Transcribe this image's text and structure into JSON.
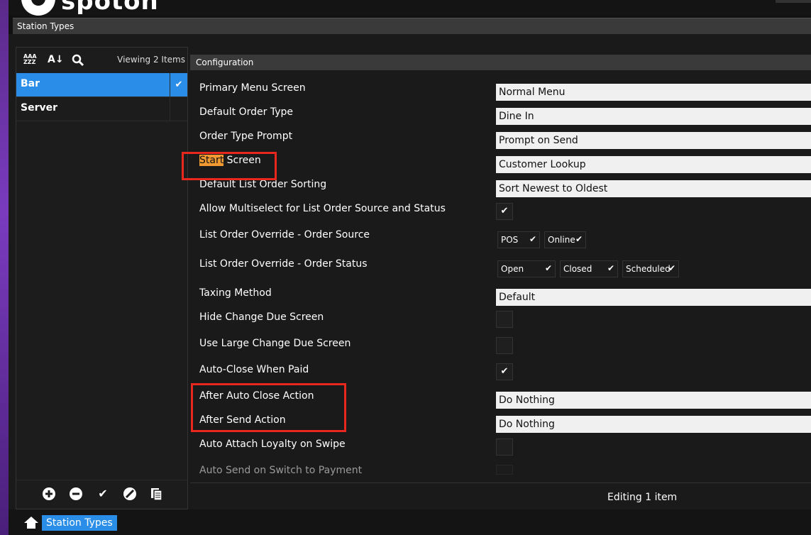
{
  "app": {
    "brand": "spoton"
  },
  "window": {
    "title": "Station Types"
  },
  "left_panel": {
    "toolbar": {
      "sort_az_icon": "AAA\nZZZ",
      "sort_num_icon": "A↓Z",
      "search_icon": "🔍",
      "viewing_text": "Viewing 2 Items"
    },
    "items": [
      {
        "label": "Bar",
        "selected": true,
        "check": "✔"
      },
      {
        "label": "Server",
        "selected": false,
        "check": ""
      }
    ],
    "bottom_icons": [
      "add-icon",
      "remove-icon",
      "check-icon",
      "disable-icon",
      "copy-icon"
    ]
  },
  "config": {
    "header": "Configuration",
    "rows": [
      {
        "label": "Primary Menu Screen",
        "value": "Normal Menu"
      },
      {
        "label": "Default Order Type",
        "value": "Dine In"
      },
      {
        "label": "Order Type Prompt",
        "value": "Prompt on Send"
      },
      {
        "label_highlight": "Start",
        "label_rest": " Screen",
        "value": "Customer Lookup"
      },
      {
        "label": "Default List Order Sorting",
        "value": "Sort Newest to Oldest"
      },
      {
        "label": "Allow Multiselect for List Order Source and Status",
        "checked": "✔"
      },
      {
        "label": "List Order Override - Order Source",
        "chips": [
          {
            "label": "POS",
            "check": "✔"
          },
          {
            "label": "Online",
            "check": "✔"
          }
        ]
      },
      {
        "label": "List Order Override - Order Status",
        "chips": [
          {
            "label": "Open",
            "check": "✔"
          },
          {
            "label": "Closed",
            "check": "✔"
          },
          {
            "label": "Scheduled",
            "check": "✔"
          }
        ]
      },
      {
        "label": "Taxing Method",
        "value": "Default"
      },
      {
        "label": "Hide Change Due Screen",
        "checked": ""
      },
      {
        "label": "Use Large Change Due Screen",
        "checked": ""
      },
      {
        "label": "Auto-Close When Paid",
        "checked": "✔"
      },
      {
        "label": "After Auto Close Action",
        "value": "Do Nothing"
      },
      {
        "label": "After Send Action",
        "value": "Do Nothing"
      },
      {
        "label": "Auto Attach Loyalty on Swipe",
        "checked": ""
      },
      {
        "label": "Auto Send on Switch to Payment",
        "checked": ""
      }
    ],
    "status": "Editing 1 item"
  },
  "bottom_nav": {
    "breadcrumb": "Station Types"
  },
  "colors": {
    "accent": "#2a8ee8",
    "highlight": "#f19a31",
    "annotation": "#e8281f"
  }
}
